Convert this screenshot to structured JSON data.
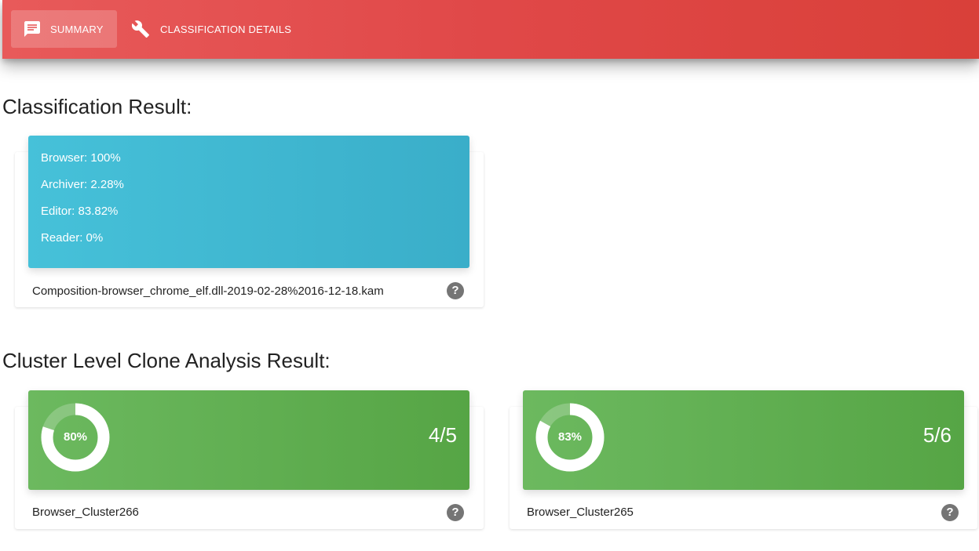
{
  "nav": {
    "tabs": [
      {
        "label": "SUMMARY",
        "icon": "comment-icon",
        "active": true
      },
      {
        "label": "CLASSIFICATION DETAILS",
        "icon": "wrench-icon",
        "active": false
      }
    ],
    "bar_color": "#e04848"
  },
  "classification": {
    "title": "Classification Result:",
    "scores": [
      {
        "text": "Browser: 100%"
      },
      {
        "text": "Archiver: 2.28%"
      },
      {
        "text": "Editor: 83.82%"
      },
      {
        "text": "Reader: 0%"
      }
    ],
    "file_name": "Composition-browser_chrome_elf.dll-2019-02-28%2016-12-18.kam",
    "help_glyph": "?",
    "header_color": "#3fb8d2"
  },
  "clusters": {
    "title": "Cluster Level Clone Analysis Result:",
    "header_color": "#5eae50",
    "items": [
      {
        "percent_label": "80%",
        "percent": 80,
        "ratio": "4/5",
        "name": "Browser_Cluster266",
        "help_glyph": "?"
      },
      {
        "percent_label": "83%",
        "percent": 83,
        "ratio": "5/6",
        "name": "Browser_Cluster265",
        "help_glyph": "?"
      }
    ]
  }
}
